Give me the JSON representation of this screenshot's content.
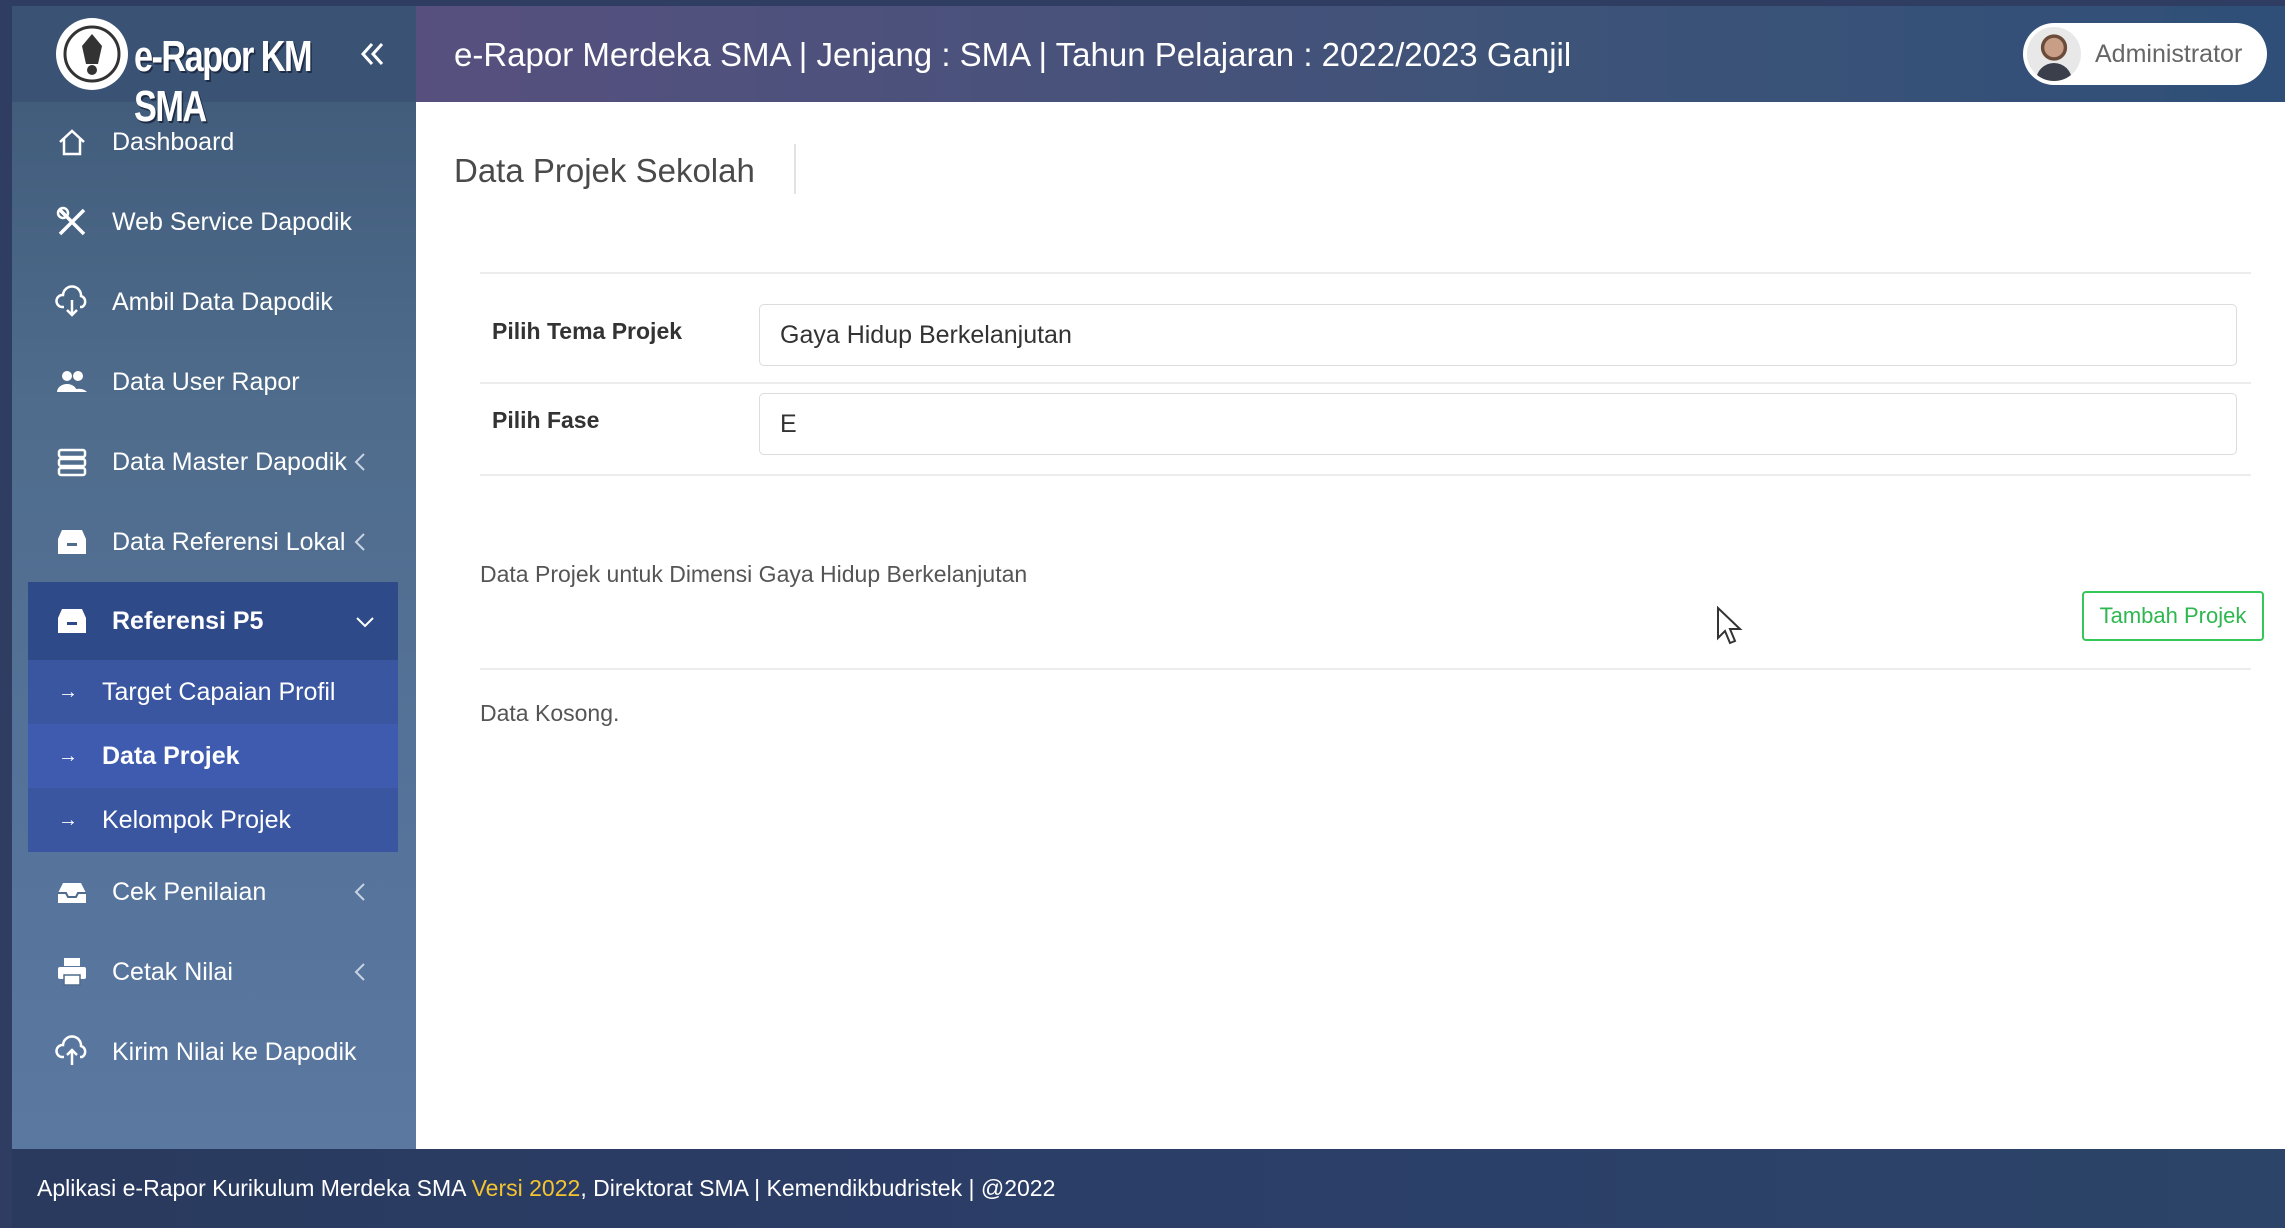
{
  "brand": {
    "name": "e-Rapor KM SMA"
  },
  "header": {
    "title": "e-Rapor Merdeka SMA | Jenjang : SMA | Tahun Pelajaran : 2022/2023 Ganjil",
    "user": "Administrator"
  },
  "sidebar": {
    "items": [
      {
        "label": "Dashboard",
        "icon": "home-icon"
      },
      {
        "label": "Web Service Dapodik",
        "icon": "tools-icon"
      },
      {
        "label": "Ambil Data Dapodik",
        "icon": "cloud-download-icon"
      },
      {
        "label": "Data User Rapor",
        "icon": "users-icon"
      },
      {
        "label": "Data Master Dapodik",
        "icon": "database-icon"
      },
      {
        "label": "Data Referensi Lokal",
        "icon": "archive-icon"
      }
    ],
    "group": {
      "label": "Referensi P5",
      "icon": "archive-icon",
      "subitems": [
        "Target Capaian Profil",
        "Data Projek",
        "Kelompok Projek"
      ]
    },
    "items_after": [
      {
        "label": "Cek Penilaian",
        "icon": "inbox-icon"
      },
      {
        "label": "Cetak Nilai",
        "icon": "printer-icon"
      },
      {
        "label": "Kirim Nilai ke Dapodik",
        "icon": "cloud-upload-icon"
      }
    ]
  },
  "main": {
    "page_title": "Data Projek Sekolah",
    "form": {
      "tema_label": "Pilih Tema Projek",
      "tema_value": "Gaya Hidup Berkelanjutan",
      "fase_label": "Pilih Fase",
      "fase_value": "E"
    },
    "section_title": "Data Projek untuk Dimensi Gaya Hidup Berkelanjutan",
    "add_button": "Tambah Projek",
    "empty_text": "Data Kosong."
  },
  "footer": {
    "text_before": "Aplikasi e-Rapor Kurikulum Merdeka SMA ",
    "version": "Versi 2022",
    "text_after": ", Direktorat SMA | Kemendikbudristek | @2022"
  },
  "colors": {
    "accent": "#34c759",
    "version": "#f4c430",
    "sidebar": "#4f6c8c"
  }
}
